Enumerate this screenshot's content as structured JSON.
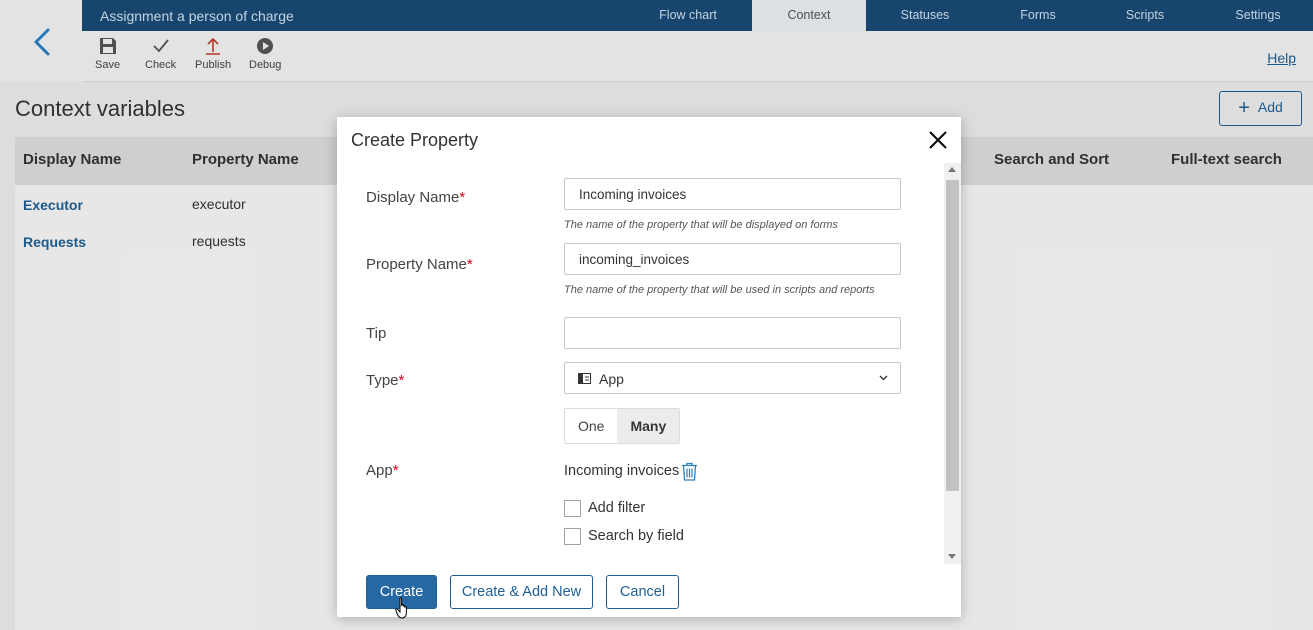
{
  "header": {
    "title": "Assignment a person of charge",
    "tabs": [
      {
        "label": "Flow chart",
        "active": false
      },
      {
        "label": "Context",
        "active": true
      },
      {
        "label": "Statuses",
        "active": false
      },
      {
        "label": "Forms",
        "active": false
      },
      {
        "label": "Scripts",
        "active": false
      },
      {
        "label": "Settings",
        "active": false
      }
    ]
  },
  "toolbar": {
    "save_label": "Save",
    "check_label": "Check",
    "publish_label": "Publish",
    "debug_label": "Debug",
    "help_label": "Help"
  },
  "page": {
    "title": "Context variables",
    "add_label": "Add"
  },
  "table": {
    "columns": [
      "Display Name",
      "Property Name",
      "Search and Sort",
      "Full-text search"
    ],
    "rows": [
      {
        "display_name": "Executor",
        "property_name": "executor"
      },
      {
        "display_name": "Requests",
        "property_name": "requests"
      }
    ]
  },
  "modal": {
    "title": "Create Property",
    "display_name": {
      "label": "Display Name",
      "required_mark": "*",
      "value": "Incoming invoices",
      "hint": "The name of the property that will be displayed on forms"
    },
    "property_name": {
      "label": "Property Name",
      "required_mark": "*",
      "value": "incoming_invoices",
      "hint": "The name of the property that will be used in scripts and reports"
    },
    "tip": {
      "label": "Tip",
      "value": ""
    },
    "type": {
      "label": "Type",
      "required_mark": "*",
      "value": "App",
      "icon": "app-icon"
    },
    "multiplicity": {
      "options": [
        "One",
        "Many"
      ],
      "selected": "Many"
    },
    "app": {
      "label": "App",
      "required_mark": "*",
      "value": "Incoming invoices"
    },
    "checkboxes": [
      {
        "label": "Add filter",
        "checked": false
      },
      {
        "label": "Search by field",
        "checked": false
      }
    ],
    "buttons": {
      "create": "Create",
      "create_add_new": "Create & Add New",
      "cancel": "Cancel"
    }
  },
  "colors": {
    "nav_bg": "#1a4a75",
    "accent": "#1e5f95",
    "primary_button": "#2568a4",
    "required": "#d0021b",
    "publish_icon": "#c0392b"
  }
}
